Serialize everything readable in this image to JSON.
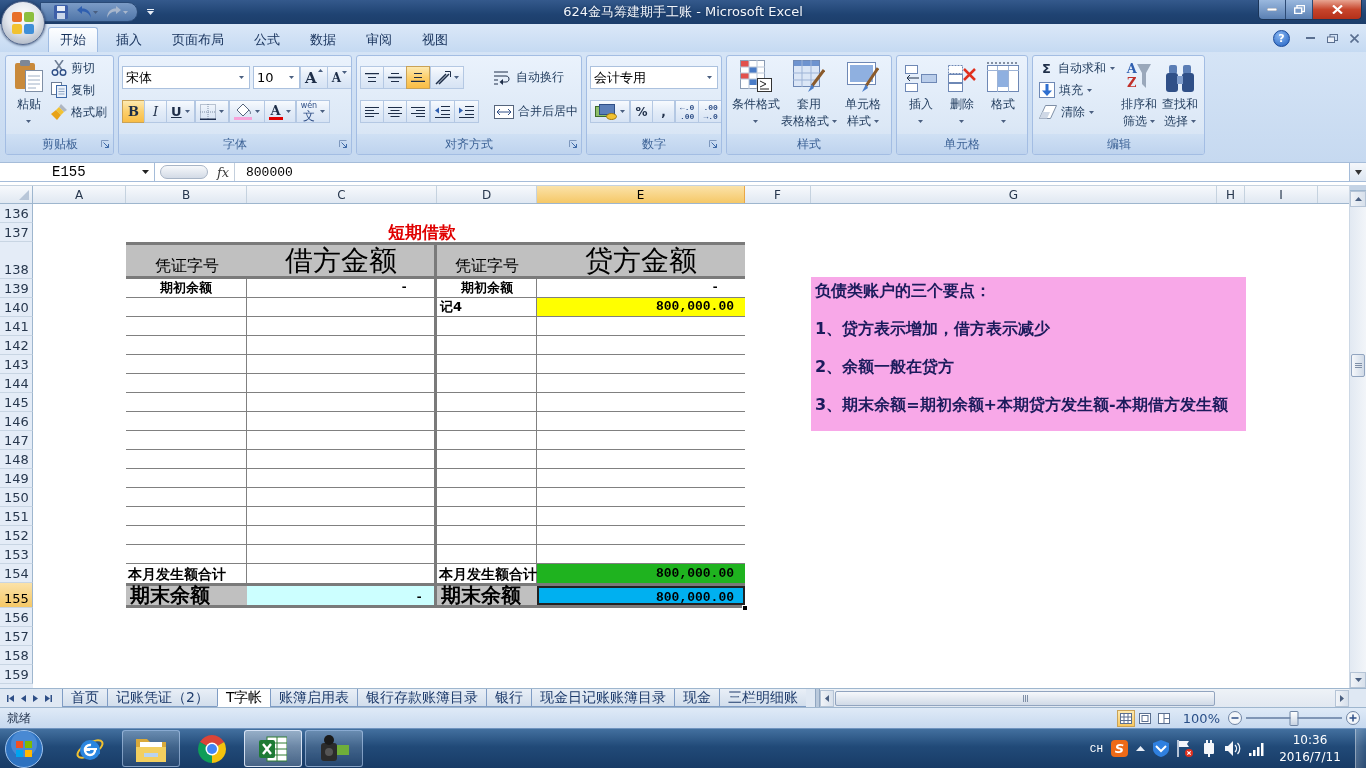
{
  "window": {
    "title": "624金马筹建期手工账 - Microsoft Excel"
  },
  "ribbon": {
    "tabs": [
      {
        "label": "开始",
        "selected": true
      },
      {
        "label": "插入",
        "selected": false
      },
      {
        "label": "页面布局",
        "selected": false
      },
      {
        "label": "公式",
        "selected": false
      },
      {
        "label": "数据",
        "selected": false
      },
      {
        "label": "审阅",
        "selected": false
      },
      {
        "label": "视图",
        "selected": false
      }
    ],
    "help": "?",
    "clipboard": {
      "title": "剪贴板",
      "paste": "粘贴",
      "cut": "剪切",
      "copy": "复制",
      "format_painter": "格式刷"
    },
    "font": {
      "title": "字体",
      "font_name": "宋体",
      "font_size": "10",
      "grow": "A",
      "shrink": "A",
      "styles": [
        {
          "label": "B",
          "selected": true
        },
        {
          "label": "I",
          "selected": false
        },
        {
          "label": "U",
          "selected": false
        }
      ],
      "font_color": "A",
      "phonetic": [
        "wén",
        "文"
      ]
    },
    "alignment": {
      "title": "对齐方式",
      "vertical": [
        {
          "selected": false
        },
        {
          "selected": false
        },
        {
          "selected": true
        }
      ],
      "horizontal": [
        {
          "selected": false
        },
        {
          "selected": false
        },
        {
          "selected": false
        }
      ],
      "wrap_text": "自动换行",
      "merge_center": "合并后居中"
    },
    "number": {
      "title": "数字",
      "format": "会计专用",
      "percent": "%",
      "comma": ",",
      "increase_decimal": [
        "←.0",
        ".00"
      ],
      "decrease_decimal": [
        ".00",
        "→.0"
      ]
    },
    "styles": {
      "title": "样式",
      "buttons": [
        [
          "条件格式"
        ],
        [
          "套用",
          "表格格式"
        ],
        [
          "单元格",
          "样式"
        ]
      ]
    },
    "cells": {
      "title": "单元格",
      "buttons": [
        "插入",
        "删除",
        "格式"
      ]
    },
    "editing": {
      "title": "编辑",
      "autosum": {
        "symbol": "Σ",
        "label": "自动求和"
      },
      "fill": "填充",
      "clear": "清除",
      "sort": {
        "glyphs": [
          "A",
          "Z"
        ],
        "label": [
          "排序和",
          "筛选"
        ]
      },
      "find": [
        "查找和",
        "选择"
      ]
    }
  },
  "formula_bar": {
    "name_box": "E155",
    "function_label": "fx",
    "value": "800000"
  },
  "sheet": {
    "columns": [
      {
        "label": "A",
        "selected": false
      },
      {
        "label": "B",
        "selected": false
      },
      {
        "label": "C",
        "selected": false
      },
      {
        "label": "D",
        "selected": false
      },
      {
        "label": "E",
        "selected": true
      },
      {
        "label": "F",
        "selected": false
      },
      {
        "label": "G",
        "selected": false
      },
      {
        "label": "H",
        "selected": false
      },
      {
        "label": "I",
        "selected": false
      }
    ],
    "rows": [
      {
        "label": "136",
        "selected": false,
        "kind": "blank"
      },
      {
        "label": "137",
        "selected": false,
        "kind": "title",
        "title": "短期借款"
      },
      {
        "label": "138",
        "selected": false,
        "kind": "header",
        "cells": {
          "debit_voucher": {
            "text": "凭证字号"
          },
          "debit_amount": {
            "text": "借方金额"
          },
          "credit_voucher": {
            "text": "凭证字号"
          },
          "credit_amount": {
            "text": "贷方金额"
          }
        }
      },
      {
        "label": "139",
        "selected": false,
        "kind": "opening",
        "cells": {
          "debit_voucher": {
            "text": "期初余额"
          },
          "debit_amount": {
            "text": "-"
          },
          "credit_voucher": {
            "text": "期初余额"
          },
          "credit_amount": {
            "text": "-"
          }
        }
      },
      {
        "label": "140",
        "selected": false,
        "kind": "entry",
        "cells": {
          "credit_voucher": {
            "text": "记4"
          },
          "credit_amount": {
            "text": "800,000.00",
            "color": "#ffff00"
          }
        }
      },
      {
        "label": "141",
        "selected": false,
        "kind": "entry"
      },
      {
        "label": "142",
        "selected": false,
        "kind": "entry"
      },
      {
        "label": "143",
        "selected": false,
        "kind": "entry"
      },
      {
        "label": "144",
        "selected": false,
        "kind": "entry"
      },
      {
        "label": "145",
        "selected": false,
        "kind": "entry"
      },
      {
        "label": "146",
        "selected": false,
        "kind": "entry"
      },
      {
        "label": "147",
        "selected": false,
        "kind": "entry"
      },
      {
        "label": "148",
        "selected": false,
        "kind": "entry"
      },
      {
        "label": "149",
        "selected": false,
        "kind": "entry"
      },
      {
        "label": "150",
        "selected": false,
        "kind": "entry"
      },
      {
        "label": "151",
        "selected": false,
        "kind": "entry"
      },
      {
        "label": "152",
        "selected": false,
        "kind": "entry"
      },
      {
        "label": "153",
        "selected": false,
        "kind": "entry"
      },
      {
        "label": "154",
        "selected": false,
        "kind": "total",
        "cells": {
          "debit_voucher": {
            "text": "本月发生额合计"
          },
          "credit_voucher": {
            "text": "本月发生额合计"
          },
          "credit_amount": {
            "text": "800,000.00",
            "color": "#1fb31f"
          }
        }
      },
      {
        "label": "155",
        "selected": true,
        "kind": "balance",
        "cells": {
          "debit_voucher": {
            "text": "期末余额"
          },
          "debit_amount": {
            "text": "-",
            "color": "#ccffff"
          },
          "credit_voucher": {
            "text": "期末余额"
          },
          "credit_amount": {
            "text": "800,000.00",
            "color": "#00b0f0"
          }
        }
      },
      {
        "label": "156",
        "selected": false,
        "kind": "blank"
      },
      {
        "label": "157",
        "selected": false,
        "kind": "blank"
      },
      {
        "label": "158",
        "selected": false,
        "kind": "blank"
      },
      {
        "label": "159",
        "selected": false,
        "kind": "blank"
      }
    ],
    "note": {
      "lines": [
        "负债类账户的三个要点：",
        "1、贷方表示增加，借方表示减少",
        "2、余额一般在贷方",
        "3、期末余额=期初余额+本期贷方发生额-本期借方发生额"
      ]
    }
  },
  "sheet_tabs": [
    {
      "label": "首页",
      "selected": false
    },
    {
      "label": "记账凭证（2）",
      "selected": false
    },
    {
      "label": "T字帐",
      "selected": true
    },
    {
      "label": "账簿启用表",
      "selected": false
    },
    {
      "label": "银行存款账簿目录",
      "selected": false
    },
    {
      "label": "银行",
      "selected": false
    },
    {
      "label": "现金日记账账簿目录",
      "selected": false
    },
    {
      "label": "现金",
      "selected": false
    },
    {
      "label": "三栏明细账",
      "selected": false
    }
  ],
  "status_bar": {
    "text": "就绪",
    "views": [
      {
        "selected": true
      },
      {
        "selected": false
      },
      {
        "selected": false
      }
    ],
    "zoom": "100%",
    "zoom_slider": {
      "level": 0.5
    }
  },
  "taskbar": {
    "apps": [
      {
        "running": false,
        "selected": false
      },
      {
        "running": true,
        "selected": false
      },
      {
        "running": false,
        "selected": false
      },
      {
        "running": true,
        "selected": true
      },
      {
        "running": true,
        "selected": false
      }
    ],
    "language": "CH",
    "ime": "S",
    "time": "10:36",
    "date": "2016/7/11"
  }
}
